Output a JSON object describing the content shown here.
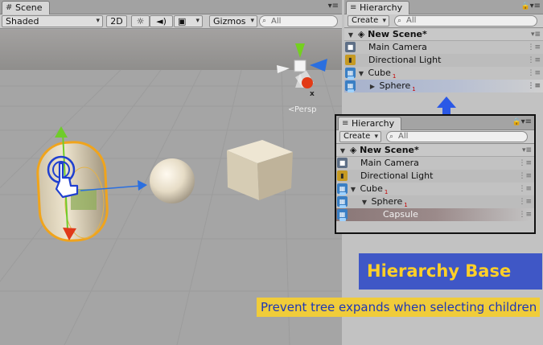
{
  "scene": {
    "tab_title": "Scene",
    "shading_mode": "Shaded",
    "mode_2d": "2D",
    "gizmos_label": "Gizmos",
    "search_placeholder": "All",
    "persp_label": "Persp",
    "axis_x_label": "x",
    "accent_colors": {
      "selection_outline": "#f0a41c",
      "y_axis": "#6fcc2a",
      "z_axis": "#2a6fe0",
      "x_axis": "#e03a1a"
    }
  },
  "hierarchy_top": {
    "tab_title": "Hierarchy",
    "create_label": "Create",
    "search_placeholder": "All",
    "scene_name": "New Scene*",
    "rows": [
      {
        "label": "Main Camera",
        "icon": "camera-icon"
      },
      {
        "label": "Directional Light",
        "icon": "light-icon"
      },
      {
        "label": "Cube",
        "badge": "1",
        "icon": "prefab-icon",
        "expanded": true
      },
      {
        "label": "Sphere",
        "badge": "1",
        "icon": "prefab-icon",
        "collapsed": true,
        "selected": true
      }
    ]
  },
  "hierarchy_zoom": {
    "tab_title": "Hierarchy",
    "create_label": "Create",
    "search_placeholder": "All",
    "scene_name": "New Scene*",
    "rows": [
      {
        "label": "Main Camera",
        "icon": "camera-icon"
      },
      {
        "label": "Directional Light",
        "icon": "light-icon"
      },
      {
        "label": "Cube",
        "badge": "1",
        "icon": "prefab-icon",
        "expanded": true
      },
      {
        "label": "Sphere",
        "badge": "1",
        "icon": "prefab-icon",
        "expanded": true
      },
      {
        "label": "Capsule",
        "selected": true
      }
    ]
  },
  "banner": {
    "title": "Hierarchy Base",
    "tagline": "Prevent tree expands when selecting children"
  }
}
